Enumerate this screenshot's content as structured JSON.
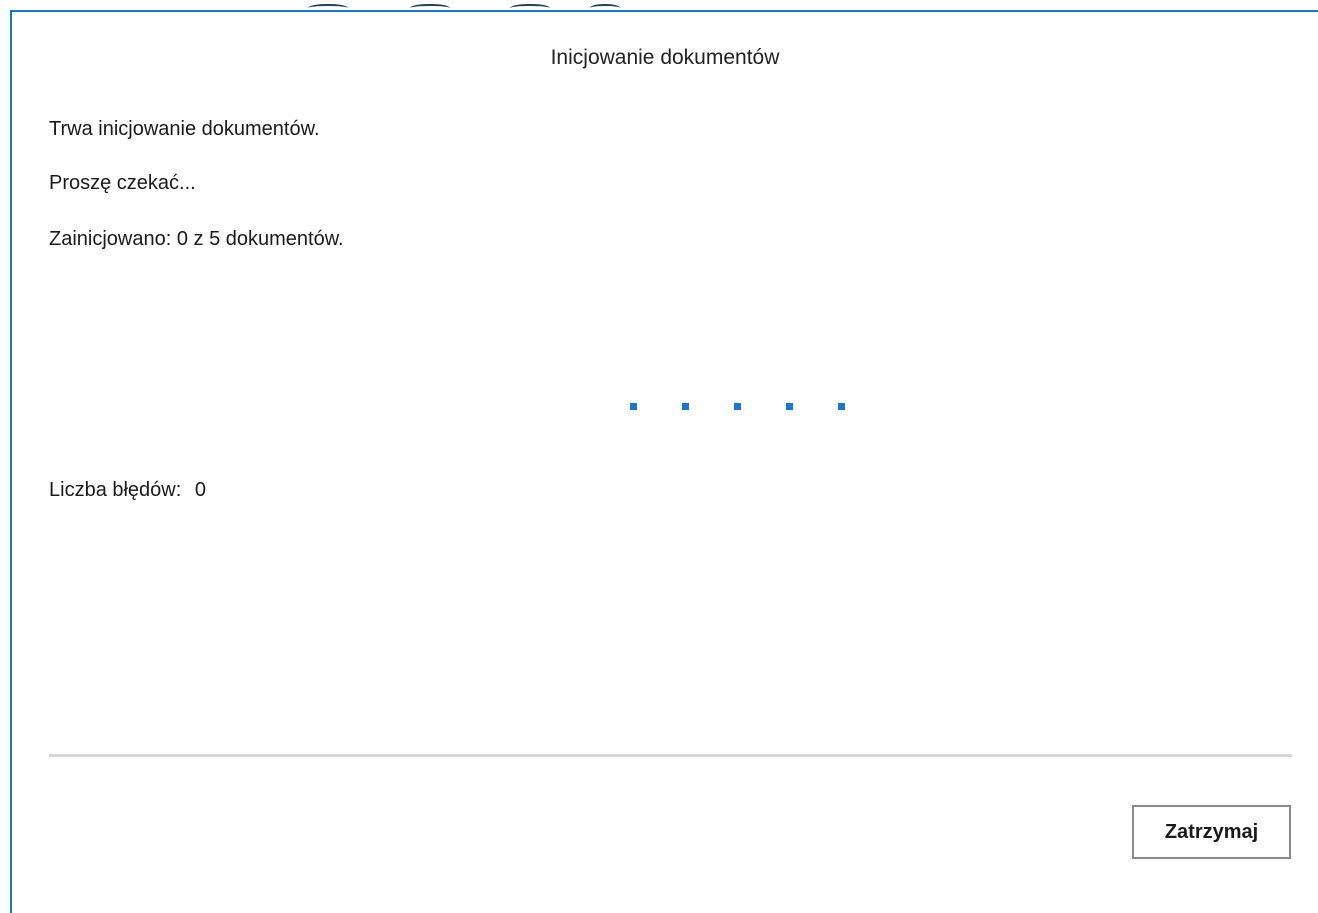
{
  "dialog": {
    "title": "Inicjowanie dokumentów",
    "status_text": "Trwa inicjowanie dokumentów.",
    "wait_text": "Proszę czekać...",
    "progress_text": "Zainicjowano: 0 z 5 dokumentów.",
    "progress": {
      "done": 0,
      "total": 5
    },
    "errors_label": "Liczba błędów:",
    "errors_count": "0",
    "stop_button_label": "Zatrzymaj"
  },
  "loading_indicator": {
    "dot_count": 5,
    "color": "#1976d2"
  },
  "colors": {
    "accent": "#1976d2",
    "separator": "#d6d6dc",
    "button_border": "#8a8a8a"
  }
}
